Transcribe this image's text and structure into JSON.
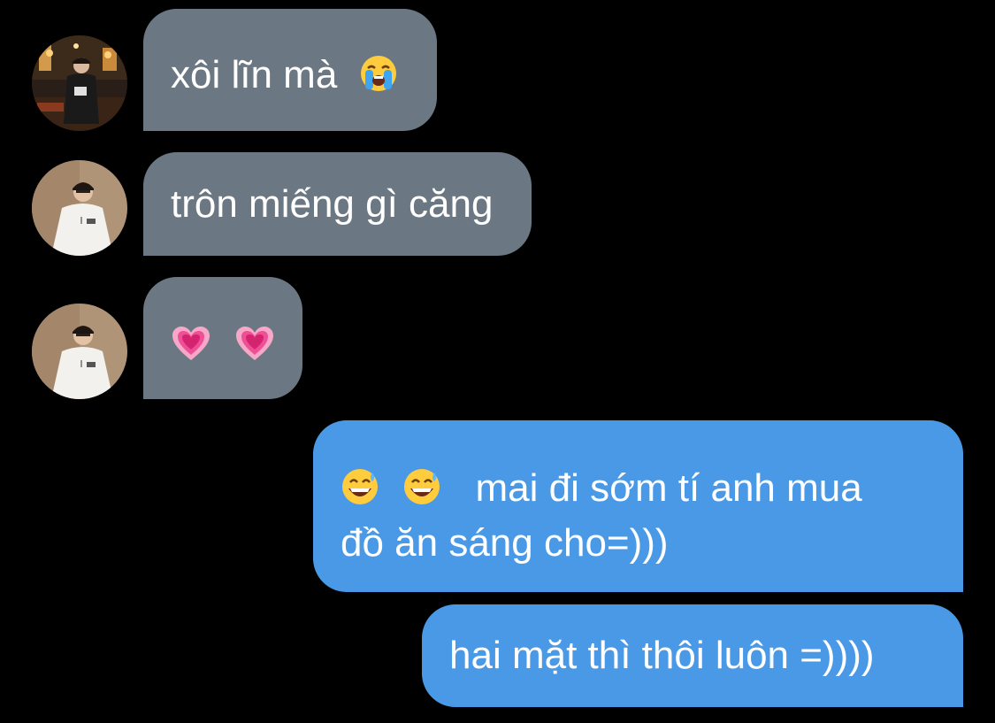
{
  "messages": [
    {
      "direction": "incoming",
      "avatar": "avatar-night-city",
      "lines": [
        "xôi lĩn mà"
      ],
      "trailing_emoji": "loudly-crying-face"
    },
    {
      "direction": "incoming",
      "avatar": "avatar-white-outfit",
      "lines": [
        "trôn miếng gì căng"
      ]
    },
    {
      "direction": "incoming",
      "avatar": "avatar-white-outfit",
      "emojis": [
        "growing-heart",
        "growing-heart"
      ]
    },
    {
      "direction": "outgoing",
      "leading_emojis": [
        "grinning-face-with-sweat",
        "grinning-face-with-sweat"
      ],
      "lines": [
        "mai đi sớm tí anh mua",
        "đồ ăn sáng cho=)))"
      ]
    },
    {
      "direction": "outgoing",
      "lines": [
        "hai mặt thì thôi luôn =))))"
      ]
    }
  ],
  "colors": {
    "background": "#000000",
    "incoming_bubble": "#6b7883",
    "outgoing_bubble": "#4a99e6",
    "text": "#ffffff"
  }
}
